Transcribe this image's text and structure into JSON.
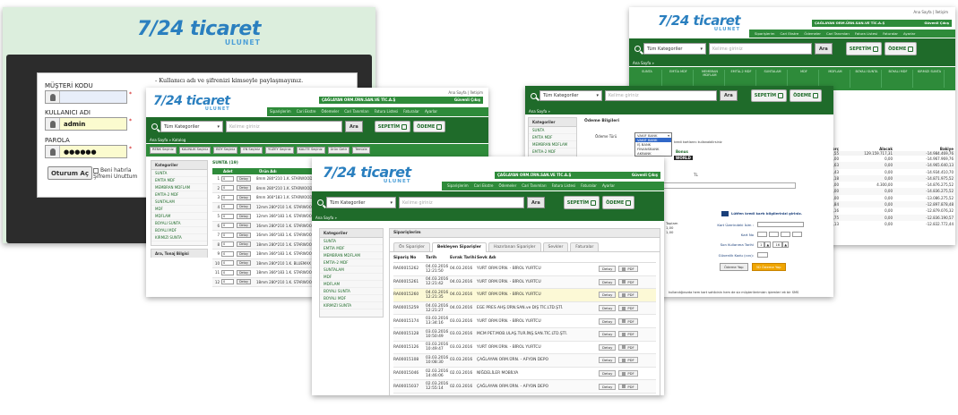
{
  "brand": {
    "logo": "7/24 ticaret",
    "logo_sub": "ULUNET"
  },
  "company_name": "ÇAĞLAYAN ORM.ÜRN.SAN.VE TİC.A.Ş",
  "top_links": {
    "my_page": "Ana Sayfa",
    "contact": "İletişim",
    "secure_exit": "Güvenli Çıkış"
  },
  "nav_items": [
    "Siparişlerim",
    "Cari Ekstre",
    "Ödemeler",
    "Cari Tanımları",
    "Fatura Listesi",
    "Faturalar",
    "Ayarlar"
  ],
  "search": {
    "category_select": "Tüm Kategoriler",
    "placeholder": "Kelime giriniz",
    "button": "Ara"
  },
  "header_buttons": {
    "cart": "SEPETİM",
    "payment": "ÖDEME"
  },
  "breadcrumb_home": "Ana Sayfa »",
  "sidebar": {
    "title": "Kategoriler",
    "items": [
      "SUNTA",
      "EMTİA MDF",
      "MEMBRAN MDFLAM",
      "EMTİA-2 MDF",
      "SUNTALAM",
      "MDF",
      "MDFLAM",
      "BOYALI SUNTA",
      "BOYALI MDF",
      "KIRMIZI SUNTA"
    ]
  },
  "login": {
    "customer_code_label": "MÜŞTERİ KODU",
    "username_label": "KULLANICI ADI",
    "username_value": "admin",
    "password_label": "PAROLA",
    "password_value": "●●●●●●",
    "warning": "- Kullanıcı adı ve şifrenizi kimseyle paylaşmayınız.",
    "submit": "Oturum Aç",
    "remember_line1": "Beni hatırla",
    "remember_line2": "Şifremi Unuttum",
    "required_mark": "*"
  },
  "catalog": {
    "breadcrumb": "Ana Sayfa » Katalog",
    "filters": [
      "RENK Seçiniz",
      "KALINLIK Seçiniz",
      "BOY Seçiniz",
      "EN Seçiniz",
      "YÜZEY Seçiniz",
      "KALİTE Seçiniz"
    ],
    "filter_buttons": [
      "Ürün Getir",
      "Temizle"
    ],
    "section_title": "SUNTA",
    "section_count": "(19)",
    "columns": [
      "Adet",
      "Ürün Adı"
    ],
    "rows": [
      {
        "n": "1",
        "name": "8mm 280*210 1.K. STARWOOD BEYAZ"
      },
      {
        "n": "2",
        "name": "8mm 280*210 1.K. STARWOOD"
      },
      {
        "n": "3",
        "name": "8mm 366*183 1.K. STARWOOD"
      },
      {
        "n": "4",
        "name": "12mm 280*210 1.K. STARWOOD"
      },
      {
        "n": "5",
        "name": "12mm 366*183 1.K. STARWOOD"
      },
      {
        "n": "6",
        "name": "16mm 280*210 1.K. STARWOOD"
      },
      {
        "n": "7",
        "name": "16mm 366*183 1.K. STARWOOD"
      },
      {
        "n": "8",
        "name": "18mm 280*210 1.K. STARWOOD"
      },
      {
        "n": "9",
        "name": "18mm 366*183 1.K. STARWOOD"
      },
      {
        "n": "10",
        "name": "18mm 280*210 1.K. BLUEMAX"
      },
      {
        "n": "11",
        "name": "18mm 366*183 1.K. STARWOOD"
      },
      {
        "n": "12",
        "name": "18mm 280*210 1.K. STARWOOD"
      }
    ],
    "qty_default": "0",
    "detail_btn": "Detay",
    "left_panel_footer": "Ara, Tonaj Bilgisi"
  },
  "orders": {
    "breadcrumb": "Ana Sayfa »",
    "panel_title": "Siparişlerim",
    "tabs": [
      "Ön Siparişler",
      "Bekleyen Siparişler",
      "Hazırlanan Siparişler",
      "Sevkler",
      "Faturalar"
    ],
    "columns": [
      "Sipariş No",
      "Tarih",
      "Evrak Tarihi",
      "Sevk Adı"
    ],
    "detail_btn": "Detay",
    "pdf_btn": "PDF",
    "rows": [
      {
        "no": "RA00015262",
        "date": "04.03.2016 12:21:50",
        "doc": "04.03.2016",
        "name": "YURT ORM.ÜRN. - BİROL YURTCU"
      },
      {
        "no": "RA00015261",
        "date": "04.03.2016 12:21:42",
        "doc": "04.03.2016",
        "name": "YURT ORM.ÜRN. - BİROL YURTCU"
      },
      {
        "no": "RA00015260",
        "date": "04.03.2016 12:21:35",
        "doc": "04.03.2016",
        "name": "YURT ORM.ÜRN. - BİROL YURTCU"
      },
      {
        "no": "RA00015259",
        "date": "04.03.2016 12:21:27",
        "doc": "04.03.2016",
        "name": "EGE PRES AHŞ.ÜRN.SAN.ve DIŞ TİC.LTD.ŞTİ."
      },
      {
        "no": "RA00015174",
        "date": "03.03.2016 13:34:16",
        "doc": "03.03.2016",
        "name": "YURT ORM.ÜRN. - BİROL YURTCU"
      },
      {
        "no": "RA00015128",
        "date": "03.03.2016 10:50:49",
        "doc": "03.03.2016",
        "name": "MCM PET.MOB.ULAŞ.TUR.İNŞ.SAN.TİC.LTD.ŞTİ."
      },
      {
        "no": "RA00015126",
        "date": "03.03.2016 10:49:47",
        "doc": "03.03.2016",
        "name": "YURT ORM.ÜRN. - BİROL YURTCU"
      },
      {
        "no": "RA00015108",
        "date": "03.03.2016 10:08:30",
        "doc": "03.03.2016",
        "name": "ÇAĞLAYAN ORM.ÜRN. - AFYON DEPO"
      },
      {
        "no": "RA00015046",
        "date": "02.03.2016 14:46:06",
        "doc": "02.03.2016",
        "name": "NİĞDELİLER MOBİLYA"
      },
      {
        "no": "RA00015037",
        "date": "02.03.2016 12:55:14",
        "doc": "02.03.2016",
        "name": "ÇAĞLAYAN ORM.ÜRN. - AFYON DEPO"
      }
    ]
  },
  "payment": {
    "breadcrumb": "Ana Sayfa »",
    "side_title": "Kategoriler",
    "panel_title": "Ödeme Bilgileri",
    "type_label": "Ödeme Türü",
    "bank_options": [
      "VAKIF BANK",
      "VAKIF BANK",
      "İŞ BANK",
      "FİNANSBANK",
      "AKBANK"
    ],
    "card_note": "kredi kartlarını kullanabilirsiniz",
    "partial_labels": [
      "Toplam",
      "1,00",
      "1,00"
    ],
    "tl": "TL",
    "card_form_title": "Lütfen kredi kartı bilgilerinizi giriniz.",
    "card_fields": [
      "Kart Üzerindeki İsim :",
      "Kart No",
      "Son Kullanma Tarihi",
      "Güvenlik Kodu (cvv):"
    ],
    "expiry_month": "1",
    "expiry_year": "16",
    "cancel_btn": "Ödeme Yap",
    "pay_btn": "3D Ödeme Yap",
    "footer_note": "kullandığınızda hem kart sahibinin hem de siz müşterilerimizin işlemleri ek bir SMS",
    "worldcard": "WORLD",
    "bonus": "Bonus"
  },
  "statement": {
    "headers": [
      "Borç",
      "Alacak",
      "Bakiye"
    ],
    "top_total": "129.159.717,31",
    "top_left": "14.175.247,55",
    "rows": [
      [
        "16.500,00",
        "0,00",
        "-14.967.969,76"
      ],
      [
        "2.329,63",
        "0,00",
        "-14.965.640,13"
      ],
      [
        "31.229,43",
        "0,00",
        "-14.934.410,70"
      ],
      [
        "62.435,18",
        "0,00",
        "-14.871.975,52"
      ],
      [
        "0,00",
        "4.300,00",
        "-14.876.275,52"
      ],
      [
        "40.000,00",
        "0,00",
        "-14.836.275,52"
      ],
      [
        "1.750.000,00",
        "0,00",
        "-13.086.275,52"
      ],
      [
        "188.397,84",
        "0,00",
        "-12.897.878,48"
      ],
      [
        "18.802,16",
        "0,00",
        "-12.879.076,32"
      ],
      [
        "42.885,75",
        "0,00",
        "-12.836.190,57"
      ],
      [
        "3.418,13",
        "0,00",
        "-12.832.772,44"
      ]
    ],
    "green_tabs": [
      "SUNTA",
      "EMTİA MDF",
      "MEMBRAN MDFLAM",
      "EMTİA-2 MDF",
      "SUNTALAM",
      "MDF",
      "MDFLAM",
      "BOYALI SUNTA",
      "BOYALI MDF",
      "KIRMIZI SUNTA"
    ],
    "breadcrumb": "Ana Sayfa »"
  }
}
